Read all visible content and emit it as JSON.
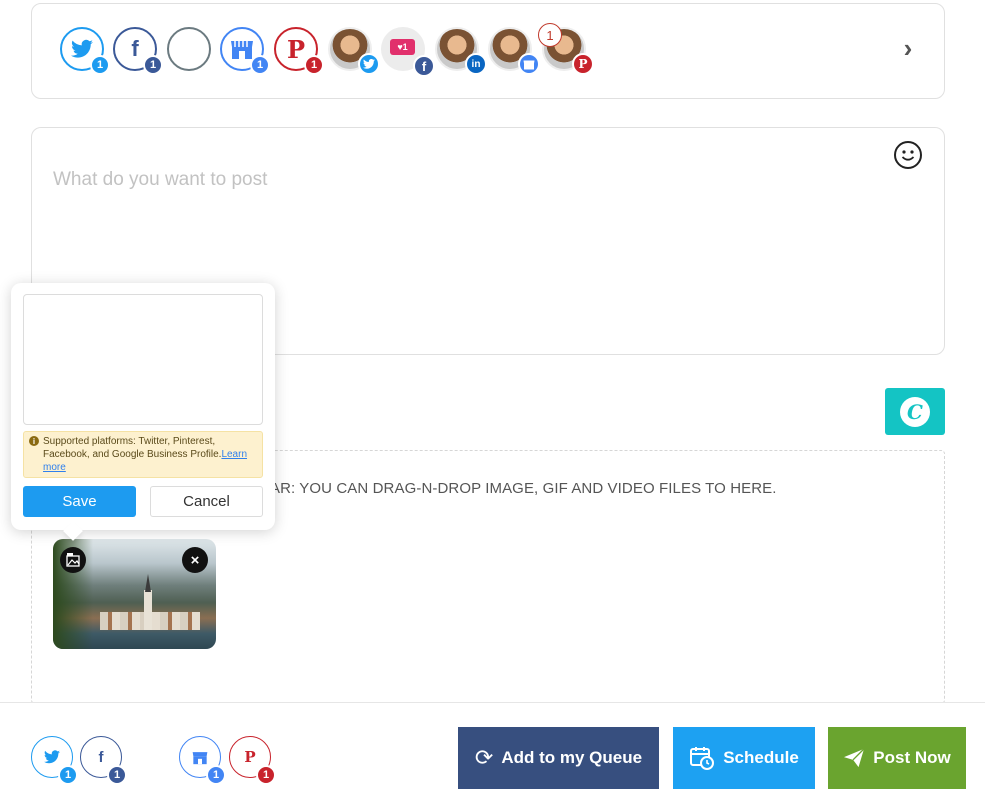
{
  "colors": {
    "twitter": "#1d9bf0",
    "facebook": "#3b5998",
    "gmb": "#4285f4",
    "pinterest": "#c8232c",
    "linkedin": "#0a66c2",
    "instagram": "#e1306c",
    "canva": "#14c4c4",
    "queue_button": "#374f7f",
    "schedule_button": "#1da1f2",
    "post_now_button": "#6aa42f",
    "notice_bg": "#fdf1cf"
  },
  "accounts": {
    "items": [
      {
        "network": "twitter",
        "icon": "twitter-bird-icon",
        "badge": "1"
      },
      {
        "network": "facebook",
        "icon": "facebook-f-icon",
        "badge": "1"
      },
      {
        "network": "empty",
        "icon": "empty-account-icon",
        "badge": ""
      },
      {
        "network": "google-business",
        "icon": "store-icon",
        "badge": "1"
      },
      {
        "network": "pinterest",
        "icon": "pinterest-p-icon",
        "badge": "1"
      }
    ],
    "profiles": [
      {
        "network": "twitter",
        "icon": "twitter-bird-icon"
      },
      {
        "network": "facebook",
        "icon": "facebook-f-icon"
      },
      {
        "network": "linkedin",
        "icon": "linkedin-in-icon"
      },
      {
        "network": "google-business",
        "icon": "store-icon"
      },
      {
        "network": "pinterest",
        "icon": "pinterest-p-icon"
      }
    ],
    "selected_count": "1"
  },
  "composer": {
    "placeholder": "What do you want to post"
  },
  "media": {
    "drop_text": "AR: YOU CAN DRAG-N-DROP IMAGE, GIF AND VIDEO FILES TO HERE."
  },
  "alt_popover": {
    "notice_text": "Supported platforms: Twitter, Pinterest, Facebook, and Google Business Profile.",
    "learn_more": "Learn more",
    "save_label": "Save",
    "cancel_label": "Cancel"
  },
  "footer": {
    "networks": [
      {
        "network": "twitter",
        "badge": "1"
      },
      {
        "network": "facebook",
        "badge": "1"
      },
      {
        "network": "google-business",
        "badge": "1"
      },
      {
        "network": "pinterest",
        "badge": "1"
      }
    ],
    "queue_label": "Add to my Queue",
    "schedule_label": "Schedule",
    "post_now_label": "Post Now"
  }
}
